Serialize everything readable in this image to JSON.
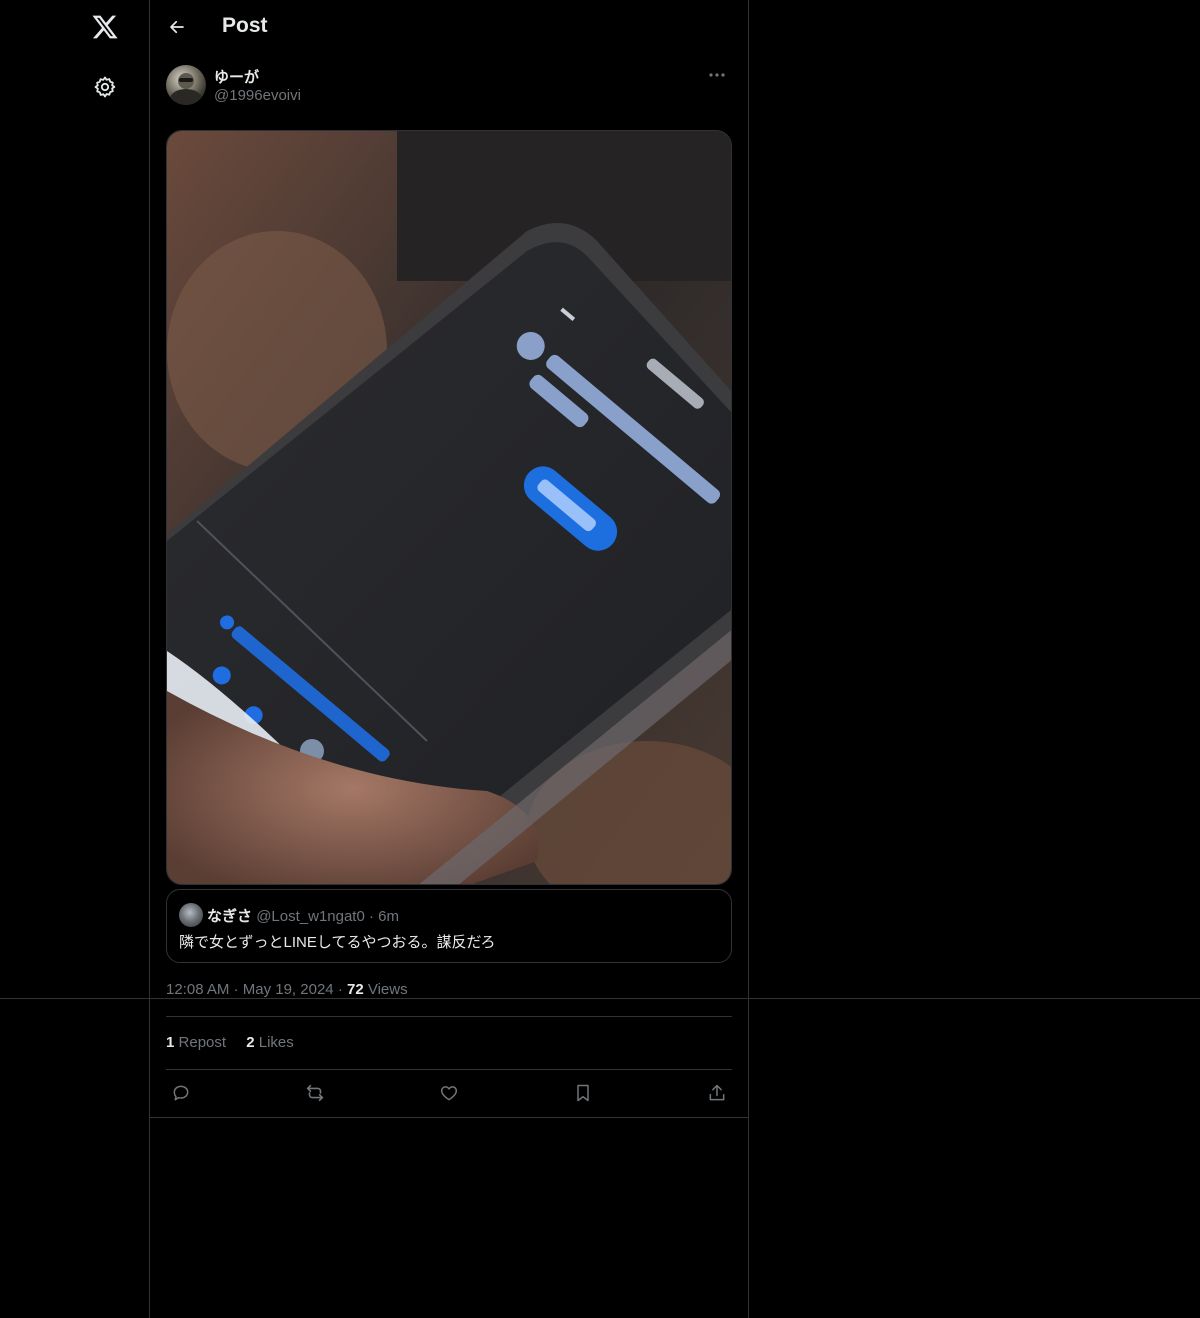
{
  "header": {
    "title": "Post"
  },
  "post": {
    "author": {
      "display_name": "ゆーが",
      "handle": "@1996evoivi"
    },
    "media_alt": "",
    "quote": {
      "display_name": "なぎさ",
      "handle": "@Lost_w1ngat0",
      "separator": "·",
      "time": "6m",
      "text": "隣で女とずっとLINEしてるやつおる。謀反だろ"
    },
    "timestamp": {
      "time": "12:08 AM",
      "dot1": "·",
      "date": "May 19, 2024",
      "dot2": "·",
      "views_count": "72",
      "views_label": "Views"
    },
    "stats": {
      "reposts_count": "1",
      "reposts_label": "Repost",
      "likes_count": "2",
      "likes_label": "Likes"
    }
  },
  "icons": {
    "logo": "x-logo-icon",
    "settings": "gear-icon",
    "back": "arrow-left-icon",
    "more": "more-horizontal-icon",
    "reply": "reply-icon",
    "repost": "repost-icon",
    "like": "heart-icon",
    "bookmark": "bookmark-icon",
    "share": "share-icon"
  },
  "colors": {
    "background": "#000000",
    "text_primary": "#e7e9ea",
    "text_secondary": "#71767b",
    "border": "#2f3336"
  }
}
